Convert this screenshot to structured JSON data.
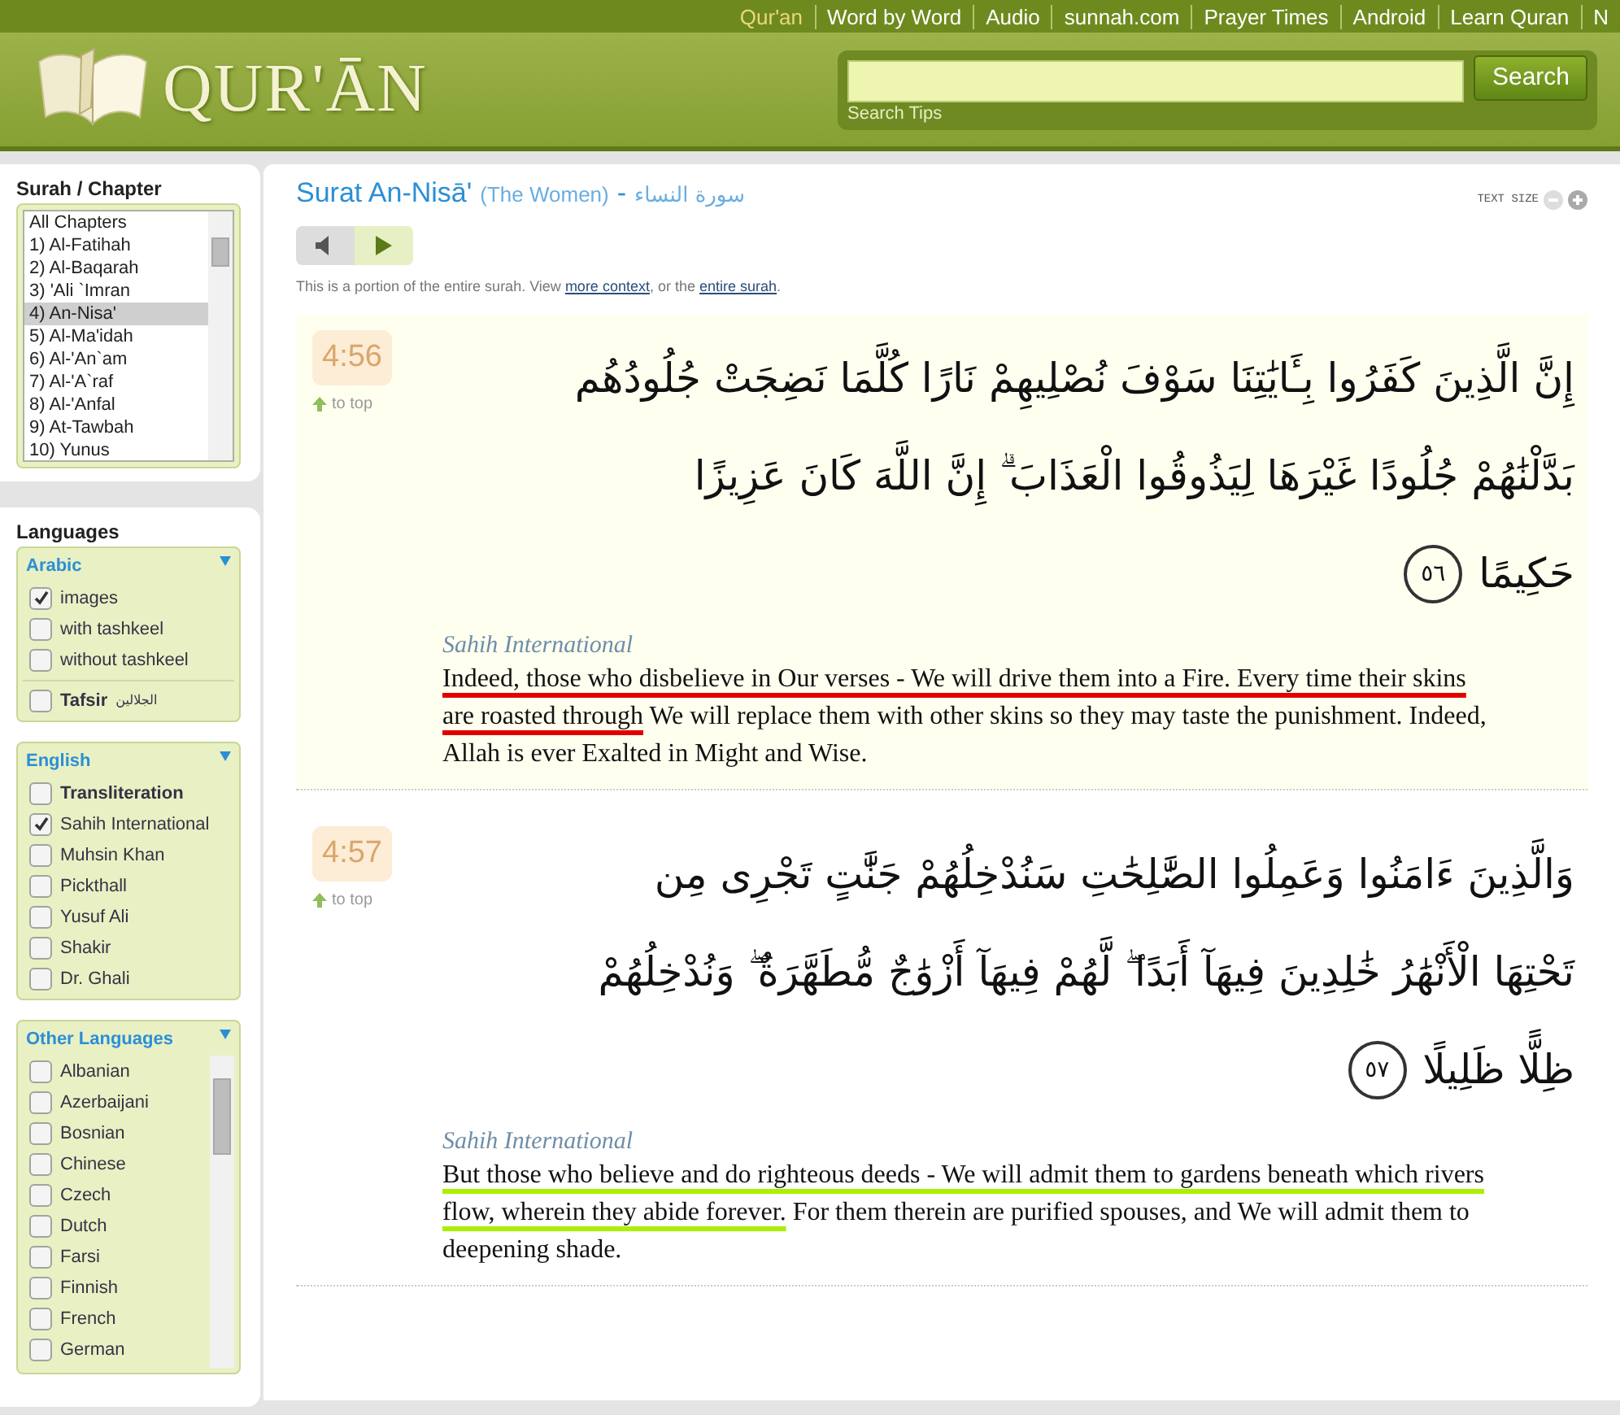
{
  "top_nav": [
    {
      "label": "Qur'an",
      "selected": true
    },
    {
      "label": "Word by Word",
      "selected": false
    },
    {
      "label": "Audio",
      "selected": false
    },
    {
      "label": "sunnah.com",
      "selected": false
    },
    {
      "label": "Prayer Times",
      "selected": false
    },
    {
      "label": "Android",
      "selected": false
    },
    {
      "label": "Learn Quran",
      "selected": false
    },
    {
      "label": "N",
      "selected": false
    }
  ],
  "header": {
    "logo_text": "QUR'ĀN",
    "search": {
      "button": "Search",
      "tips": "Search Tips"
    }
  },
  "sidebar": {
    "surah_title": "Surah / Chapter",
    "surahs": [
      {
        "label": "All Chapters",
        "selected": false
      },
      {
        "label": "1) Al-Fatihah",
        "selected": false
      },
      {
        "label": "2) Al-Baqarah",
        "selected": false
      },
      {
        "label": "3) 'Ali `Imran",
        "selected": false
      },
      {
        "label": "4) An-Nisa'",
        "selected": true
      },
      {
        "label": "5) Al-Ma'idah",
        "selected": false
      },
      {
        "label": "6) Al-'An`am",
        "selected": false
      },
      {
        "label": "7) Al-'A`raf",
        "selected": false
      },
      {
        "label": "8) Al-'Anfal",
        "selected": false
      },
      {
        "label": "9) At-Tawbah",
        "selected": false
      },
      {
        "label": "10) Yunus",
        "selected": false
      }
    ],
    "languages_title": "Languages",
    "groups": [
      {
        "title": "Arabic",
        "items": [
          {
            "label": "images",
            "checked": true,
            "kind": "plain"
          },
          {
            "label": "with tashkeel",
            "checked": false,
            "kind": "plain"
          },
          {
            "label": "without tashkeel",
            "checked": false,
            "kind": "plain"
          },
          {
            "label": "Tafsir",
            "note": "الجلالين",
            "checked": false,
            "kind": "tafsir"
          }
        ]
      },
      {
        "title": "English",
        "items": [
          {
            "label": "Transliteration",
            "checked": false,
            "kind": "bold"
          },
          {
            "label": "Sahih International",
            "checked": true,
            "kind": "plain"
          },
          {
            "label": "Muhsin Khan",
            "checked": false,
            "kind": "plain"
          },
          {
            "label": "Pickthall",
            "checked": false,
            "kind": "plain"
          },
          {
            "label": "Yusuf Ali",
            "checked": false,
            "kind": "plain"
          },
          {
            "label": "Shakir",
            "checked": false,
            "kind": "plain"
          },
          {
            "label": "Dr. Ghali",
            "checked": false,
            "kind": "plain"
          }
        ]
      },
      {
        "title": "Other Languages",
        "scroll": true,
        "items": [
          {
            "label": "Albanian",
            "checked": false,
            "kind": "plain"
          },
          {
            "label": "Azerbaijani",
            "checked": false,
            "kind": "plain"
          },
          {
            "label": "Bosnian",
            "checked": false,
            "kind": "plain"
          },
          {
            "label": "Chinese",
            "checked": false,
            "kind": "plain"
          },
          {
            "label": "Czech",
            "checked": false,
            "kind": "plain"
          },
          {
            "label": "Dutch",
            "checked": false,
            "kind": "plain"
          },
          {
            "label": "Farsi",
            "checked": false,
            "kind": "plain"
          },
          {
            "label": "Finnish",
            "checked": false,
            "kind": "plain"
          },
          {
            "label": "French",
            "checked": false,
            "kind": "plain"
          },
          {
            "label": "German",
            "checked": false,
            "kind": "plain"
          }
        ]
      }
    ]
  },
  "main": {
    "title": "Surat An-Nisā'",
    "subtitle": "(The Women)",
    "dash": "-",
    "title_ar": "سورة النساء",
    "text_size_label": "TEXT SIZE",
    "note": {
      "before": "This is a portion of the entire surah. View",
      "link1": "more context",
      "middle": ", or the",
      "link2": "entire surah",
      "after": "."
    },
    "verses": [
      {
        "ref": "4:56",
        "to_top": "to top",
        "highlighted": true,
        "arabic_lines": [
          "إِنَّ الَّذِينَ كَفَرُوا بِـَٔايَٰتِنَا سَوْفَ نُصْلِيهِمْ نَارًا كُلَّمَا نَضِجَتْ جُلُودُهُم",
          "بَدَّلْنَٰهُمْ جُلُودًا غَيْرَهَا لِيَذُوقُوا الْعَذَابَ ۗ إِنَّ اللَّهَ كَانَ عَزِيزًا",
          "حَكِيمًا"
        ],
        "number_ar": "٥٦",
        "translator": "Sahih International",
        "segments": [
          {
            "text": "Indeed, those who disbelieve in Our verses - We will drive them into a Fire. Every time their skins are roasted through",
            "color": "#e00000"
          },
          {
            "text": " We will replace them with other skins so they may taste the punishment. Indeed, Allah is ever Exalted in Might and Wise."
          }
        ]
      },
      {
        "ref": "4:57",
        "to_top": "to top",
        "highlighted": false,
        "arabic_lines": [
          "وَالَّذِينَ ءَامَنُوا وَعَمِلُوا الصَّٰلِحَٰتِ سَنُدْخِلُهُمْ جَنَّٰتٍ تَجْرِى مِن",
          "تَحْتِهَا الْأَنْهَٰرُ خَٰلِدِينَ فِيهَآ أَبَدًا ۖ لَّهُمْ فِيهَآ أَزْوَٰجٌ مُّطَهَّرَةٌ ۖ وَنُدْخِلُهُمْ",
          "ظِلًّا ظَلِيلًا"
        ],
        "number_ar": "٥٧",
        "translator": "Sahih International",
        "segments": [
          {
            "text": "But those who believe and do righteous deeds - We will admit them to gardens beneath which rivers flow, wherein they abide forever.",
            "color": "#aaf000"
          },
          {
            "text": " For them therein are purified spouses, and We will admit them to deepening shade."
          }
        ]
      }
    ]
  }
}
